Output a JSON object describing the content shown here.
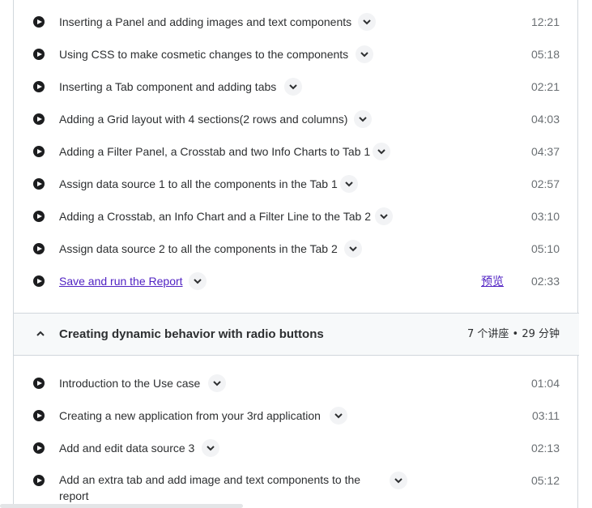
{
  "lectures_top": [
    {
      "title": "Inserting a Panel and adding images and text components",
      "duration": "12:21"
    },
    {
      "title": "Using CSS to make cosmetic changes to the components",
      "duration": "05:18"
    },
    {
      "title": "Inserting a Tab component and adding tabs",
      "duration": "02:21"
    },
    {
      "title": "Adding a Grid layout with 4 sections(2 rows and columns)",
      "duration": "04:03"
    },
    {
      "title": "Adding a Filter Panel, a Crosstab and two Info Charts to Tab 1",
      "duration": "04:37"
    },
    {
      "title": "Assign data source 1 to all the components in the Tab 1",
      "duration": "02:57"
    },
    {
      "title": "Adding a Crosstab, an Info Chart and a Filter Line to the Tab 2",
      "duration": "03:10"
    },
    {
      "title": "Assign data source 2 to all the components in the Tab 2",
      "duration": "05:10"
    },
    {
      "title": "Save and run the Report",
      "duration": "02:33",
      "preview_label": "预览"
    }
  ],
  "section": {
    "title": "Creating dynamic behavior with radio buttons",
    "meta": "7 个讲座 • 29 分钟"
  },
  "lectures_bottom": [
    {
      "title": "Introduction to the Use case",
      "duration": "01:04"
    },
    {
      "title": "Creating a new application from your 3rd application",
      "duration": "03:11"
    },
    {
      "title": "Add and edit data source 3",
      "duration": "02:13"
    },
    {
      "title": "Add an extra tab and add image and text components to the report",
      "duration": "05:12"
    }
  ],
  "icons": {
    "play": "play-circle-icon",
    "expand": "chevron-down-icon",
    "collapse": "chevron-up-icon"
  },
  "colors": {
    "link": "#5022c3",
    "text": "#2d2f31",
    "muted": "#6a6f73",
    "header_bg": "#f7f9fa"
  }
}
